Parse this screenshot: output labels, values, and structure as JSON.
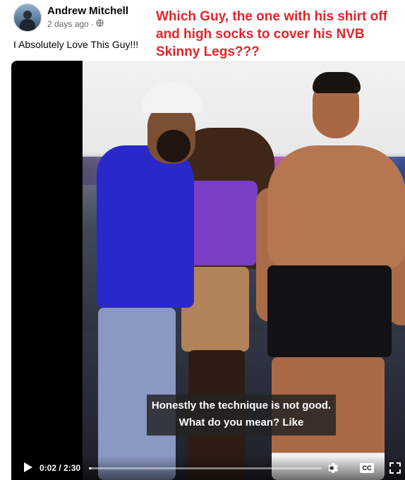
{
  "post": {
    "author": "Andrew Mitchell",
    "timestamp": "2 days ago",
    "separator": "·",
    "privacy_icon": "globe-icon",
    "caption": "I Absolutely Love This Guy!!!"
  },
  "annotation": {
    "text": "Which Guy, the one with his shirt off and high socks to cover his NVB Skinny Legs???",
    "color": "#e0262b"
  },
  "video": {
    "subtitle": "Honestly the technique is not good. What do you mean? Like",
    "current_time": "0:02",
    "duration": "2:30",
    "time_separator": " / ",
    "progress": 0.013,
    "cc_label": "CC",
    "icons": [
      "play-icon",
      "settings-gear-icon",
      "closed-captions-icon",
      "fullscreen-icon"
    ]
  }
}
